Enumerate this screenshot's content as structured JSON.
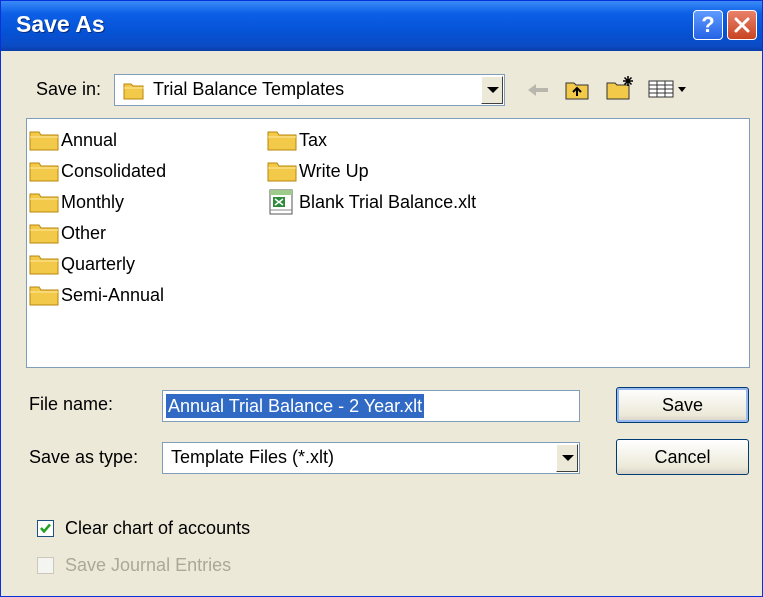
{
  "dialog": {
    "title": "Save As"
  },
  "save_in": {
    "label": "Save in:",
    "value": "Trial Balance Templates"
  },
  "toolbar": {
    "icons": [
      "back-arrow-icon",
      "up-folder-icon",
      "new-folder-icon",
      "views-menu-icon"
    ]
  },
  "file_list": {
    "items": [
      {
        "name": "Annual",
        "type": "folder"
      },
      {
        "name": "Consolidated",
        "type": "folder"
      },
      {
        "name": "Monthly",
        "type": "folder"
      },
      {
        "name": "Other",
        "type": "folder"
      },
      {
        "name": "Quarterly",
        "type": "folder"
      },
      {
        "name": "Semi-Annual",
        "type": "folder"
      },
      {
        "name": "Tax",
        "type": "folder"
      },
      {
        "name": "Write Up",
        "type": "folder"
      },
      {
        "name": "Blank Trial Balance.xlt",
        "type": "excel-template"
      }
    ]
  },
  "file_name": {
    "label": "File name:",
    "value": "Annual Trial Balance - 2 Year.xlt"
  },
  "save_as_type": {
    "label": "Save as type:",
    "value": "Template Files (*.xlt)"
  },
  "buttons": {
    "save": "Save",
    "cancel": "Cancel"
  },
  "options": {
    "clear_chart": {
      "label": "Clear chart of accounts",
      "checked": true,
      "enabled": true
    },
    "save_journal": {
      "label": "Save Journal Entries",
      "checked": false,
      "enabled": false
    }
  },
  "colors": {
    "titlebar": "#0553d7",
    "dialog_bg": "#ece9d8",
    "selection": "#316ac5",
    "folder": "#f3c94a"
  }
}
